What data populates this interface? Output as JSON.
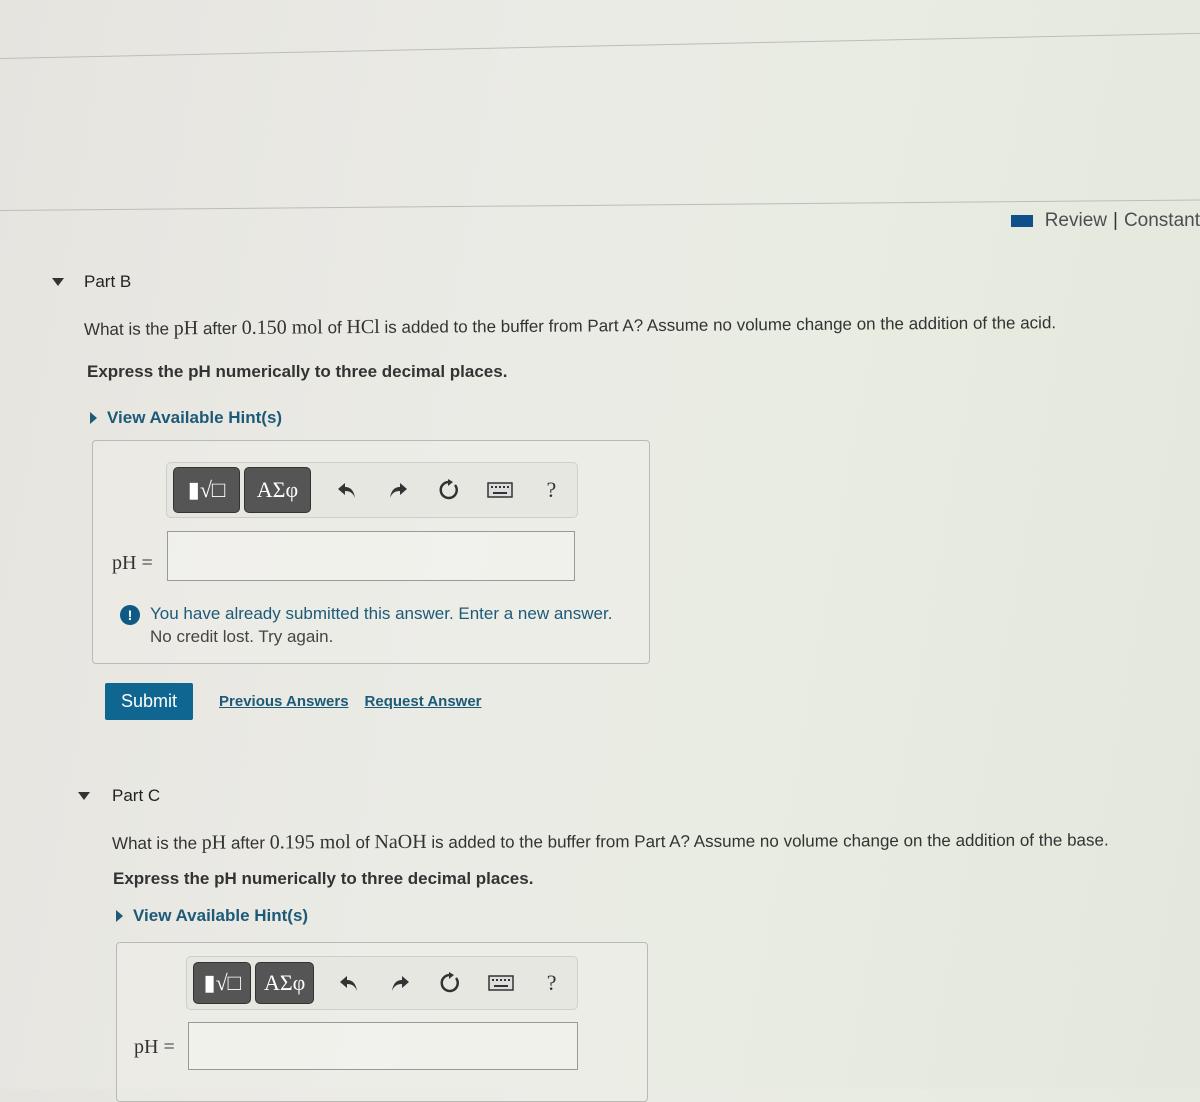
{
  "header": {
    "review_label": "Review",
    "separator": "|",
    "constants_label": "Constant"
  },
  "toolbar": {
    "templates_label": "▮√□",
    "greek_label": "ΑΣφ",
    "help_label": "?"
  },
  "part_b": {
    "title": "Part B",
    "question": {
      "t1": "What is the ",
      "m1": "pH",
      "t2": " after ",
      "m2": "0.150 mol",
      "t3": " of ",
      "m3": "HCl",
      "t4": " is added to the buffer from Part A? Assume no volume change on the addition of the acid."
    },
    "instruction": "Express the pH numerically to three decimal places.",
    "hint_label": "View Available Hint(s)",
    "answer_label": "pH =",
    "answer_value": "",
    "feedback_line1": "You have already submitted this answer. Enter a new answer.",
    "feedback_line2": "No credit lost. Try again.",
    "submit_label": "Submit",
    "previous_answers_label": "Previous Answers",
    "request_answer_label": "Request Answer"
  },
  "part_c": {
    "title": "Part C",
    "question": {
      "t1": "What is the ",
      "m1": "pH",
      "t2": " after ",
      "m2": "0.195 mol",
      "t3": " of ",
      "m3": "NaOH",
      "t4": " is added to the buffer from Part A? Assume no volume change on the addition of the base."
    },
    "instruction": "Express the pH numerically to three decimal places.",
    "hint_label": "View Available Hint(s)",
    "answer_label": "pH =",
    "answer_value": ""
  }
}
